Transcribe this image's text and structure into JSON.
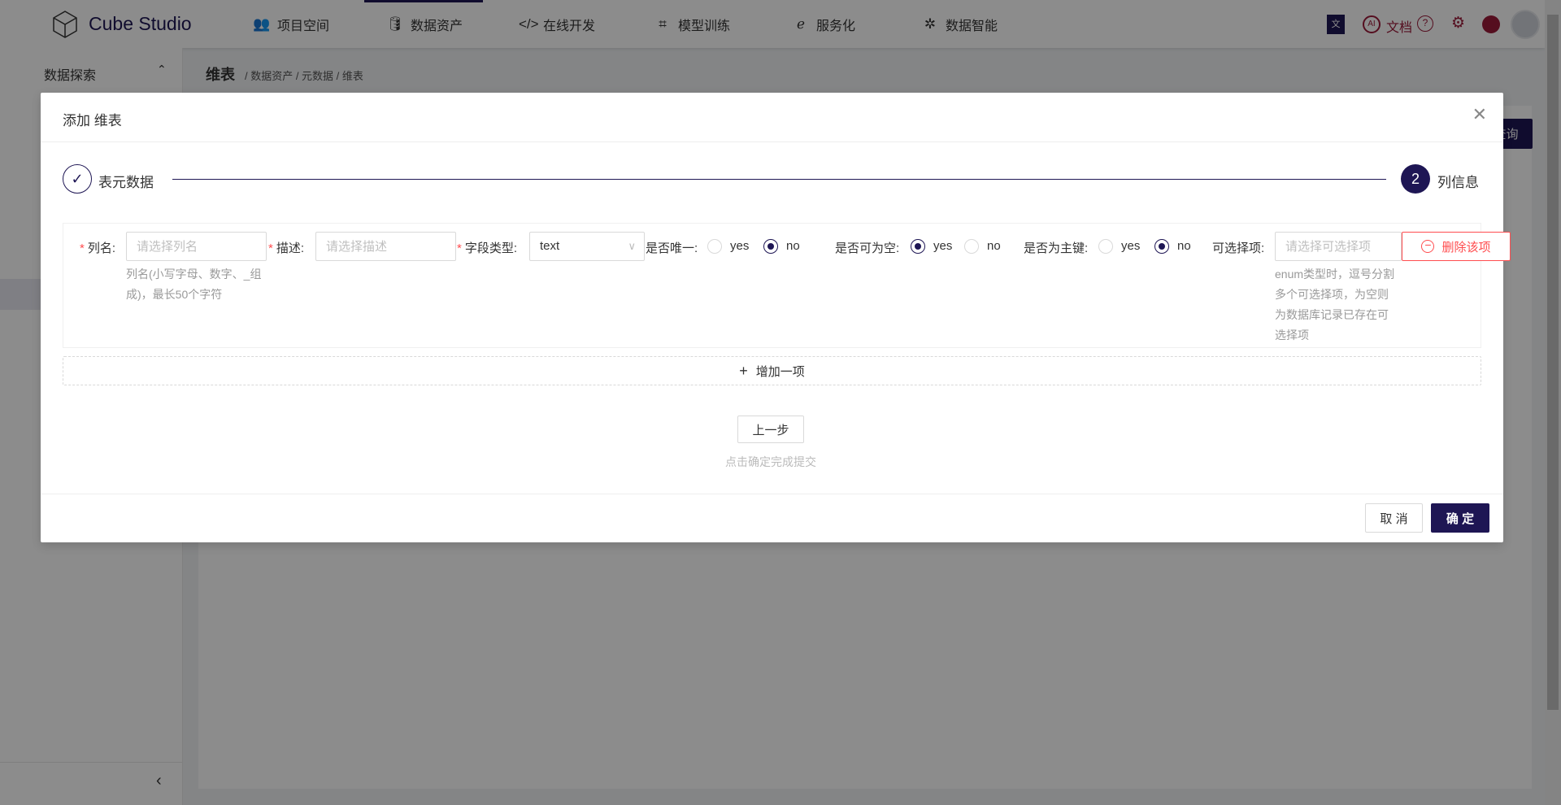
{
  "header": {
    "brand": "Cube Studio",
    "nav": [
      {
        "label": "项目空间",
        "icon": "team-icon"
      },
      {
        "label": "数据资产",
        "icon": "database-icon",
        "active": true
      },
      {
        "label": "在线开发",
        "icon": "code-icon"
      },
      {
        "label": "模型训练",
        "icon": "model-icon"
      },
      {
        "label": "服务化",
        "icon": "service-icon"
      },
      {
        "label": "数据智能",
        "icon": "openai-icon"
      }
    ],
    "right": {
      "ai": "AI",
      "docs": "文档",
      "help": "?"
    }
  },
  "sidebar": {
    "section": "数据探索"
  },
  "page": {
    "title": "维表",
    "breadcrumb": "/ 数据资产 / 元数据 / 维表",
    "query_button": "查询"
  },
  "modal": {
    "title": "添加 维表",
    "steps": [
      {
        "label": "表元数据",
        "status": "done"
      },
      {
        "number": "2",
        "label": "列信息",
        "status": "current"
      }
    ],
    "row": {
      "col_name": {
        "label": "列名",
        "placeholder": "请选择列名",
        "hint": "列名(小写字母、数字、_组成)，最长50个字符"
      },
      "desc": {
        "label": "描述",
        "placeholder": "请选择描述"
      },
      "type": {
        "label": "字段类型",
        "value": "text"
      },
      "unique": {
        "label": "是否唯一",
        "yes": "yes",
        "no": "no",
        "selected": "no"
      },
      "nullable": {
        "label": "是否可为空",
        "yes": "yes",
        "no": "no",
        "selected": "yes"
      },
      "primary": {
        "label": "是否为主键",
        "yes": "yes",
        "no": "no",
        "selected": "no"
      },
      "options": {
        "label": "可选择项",
        "placeholder": "请选择可选择项",
        "hint": "enum类型时，逗号分割多个可选择项，为空则为数据库记录已存在可选择项"
      },
      "delete_label": "删除该项"
    },
    "add_label": "增加一项",
    "prev_label": "上一步",
    "submit_hint": "点击确定完成提交",
    "cancel_label": "取 消",
    "ok_label": "确 定"
  },
  "colors": {
    "accent": "#1e1654",
    "danger": "#ff4d4f"
  }
}
